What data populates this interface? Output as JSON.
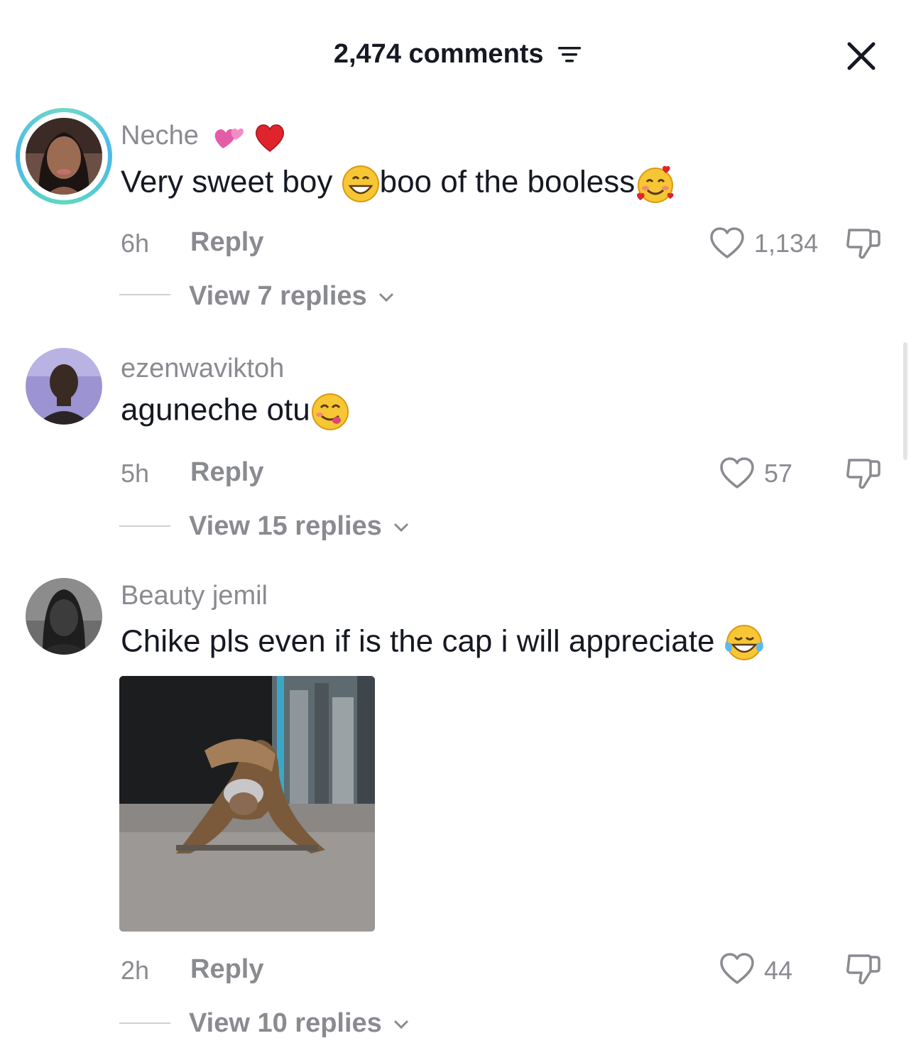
{
  "header": {
    "comment_count": "2,474 comments"
  },
  "icons": {
    "sort": "sort-lines-icon",
    "close": "close-icon",
    "like": "heart-outline-icon",
    "dislike": "thumbs-down-icon",
    "chevron": "chevron-down-icon"
  },
  "comments": [
    {
      "username": "Neche",
      "username_emojis": [
        "two-hearts-emoji",
        "red-heart-emoji"
      ],
      "text_part1": "Very sweet boy ",
      "text_emoji1": "grinning-face-emoji",
      "text_part2": "boo of the booless",
      "text_emoji2": "smiling-face-with-hearts-emoji",
      "time": "6h",
      "reply_label": "Reply",
      "likes": "1,134",
      "view_replies": "View 7 replies"
    },
    {
      "username": "ezenwaviktoh",
      "text_part1": "aguneche otu",
      "text_emoji1": "face-savoring-food-emoji",
      "time": "5h",
      "reply_label": "Reply",
      "likes": "57",
      "view_replies": "View 15 replies"
    },
    {
      "username": "Beauty jemil",
      "text_part1": "Chike pls even if is the cap i will appreciate ",
      "text_emoji1": "face-with-tears-of-joy-emoji",
      "has_image": true,
      "time": "2h",
      "reply_label": "Reply",
      "likes": "44",
      "view_replies": "View 10 replies"
    }
  ]
}
